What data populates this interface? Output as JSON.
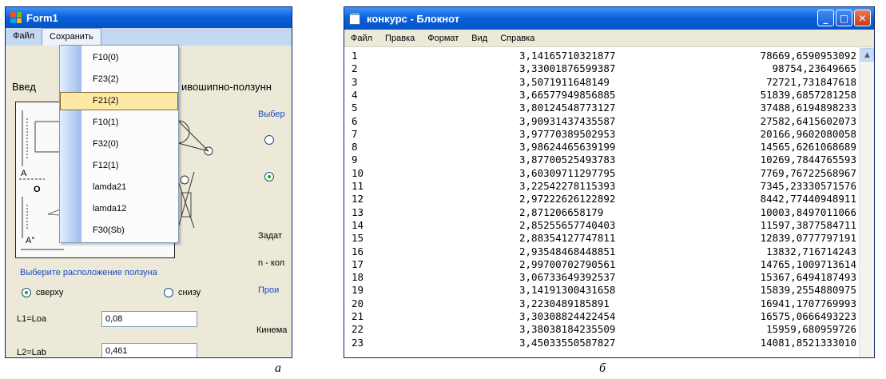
{
  "form1": {
    "title": "Form1",
    "menu": [
      "Файл",
      "Сохранить"
    ],
    "heading_left": "Введ",
    "heading_right": "ивошипно-ползунн",
    "dropdown_items": [
      "F10(0)",
      "F23(2)",
      "F21(2)",
      "F10(1)",
      "F32(0)",
      "F12(1)",
      "lamda21",
      "lamda12",
      "F30(Sb)"
    ],
    "highlighted_item": "F21(2)",
    "diagram_labels": {
      "a1": "A",
      "o": "O",
      "a2": "A''"
    },
    "side_labels": {
      "select": "Выбер",
      "set": "Задат",
      "n": "n - кол",
      "produce": "Прои",
      "kinema": "Кинема"
    },
    "slider_position_label": "Выберите расположение ползуна",
    "radio_top": "сверху",
    "radio_bottom": "снизу",
    "fields": [
      {
        "label": "L1=Loa",
        "value": "0,08"
      },
      {
        "label": "L2=Lab",
        "value": "0,461"
      }
    ]
  },
  "notepad": {
    "title": "конкурс - Блокнот",
    "menu": [
      "Файл",
      "Правка",
      "Формат",
      "Вид",
      "Справка"
    ],
    "rows": [
      [
        "1",
        "3,14165710321877",
        "78669,6590953092"
      ],
      [
        "2",
        "3,33001876599387",
        "98754,23649665"
      ],
      [
        "3",
        "3,5071911648149",
        "72721,731847618"
      ],
      [
        "4",
        "3,66577949856885",
        "51839,6857281258"
      ],
      [
        "5",
        "3,80124548773127",
        "37488,6194898233"
      ],
      [
        "6",
        "3,90931437435587",
        "27582,6415602073"
      ],
      [
        "7",
        "3,97770389502953",
        "20166,9602080058"
      ],
      [
        "8",
        "3,98624465639199",
        "14565,6261068689"
      ],
      [
        "9",
        "3,87700525493783",
        "10269,7844765593"
      ],
      [
        "10",
        "3,60309711297795",
        "7769,76722568967"
      ],
      [
        "11",
        "3,22542278115393",
        "7345,23330571576"
      ],
      [
        "12",
        "2,97222626122892",
        "8442,77440948911"
      ],
      [
        "13",
        "2,871206658179",
        "10003,8497011066"
      ],
      [
        "14",
        "2,85255657740403",
        "11597,3877584711"
      ],
      [
        "15",
        "2,88354127747811",
        "12839,0777797191"
      ],
      [
        "16",
        "2,93548468448851",
        "13832,716714243"
      ],
      [
        "17",
        "2,99700702790561",
        "14765,1009713614"
      ],
      [
        "18",
        "3,06733649392537",
        "15367,6494187493"
      ],
      [
        "19",
        "3,14191300431658",
        "15839,2554880975"
      ],
      [
        "20",
        "3,2230489185891",
        "16941,1707769993"
      ],
      [
        "21",
        "3,30308824422454",
        "16575,0666493223"
      ],
      [
        "22",
        "3,38038184235509",
        "15959,680959726"
      ],
      [
        "23",
        "3,45033550587827",
        "14081,8521333010"
      ]
    ]
  },
  "captions": {
    "a": "а",
    "b": "б"
  },
  "colors": {
    "titlebar": "#0a5fd8",
    "menu_highlight": "#fde9a4",
    "link_blue": "#1b48c2"
  }
}
